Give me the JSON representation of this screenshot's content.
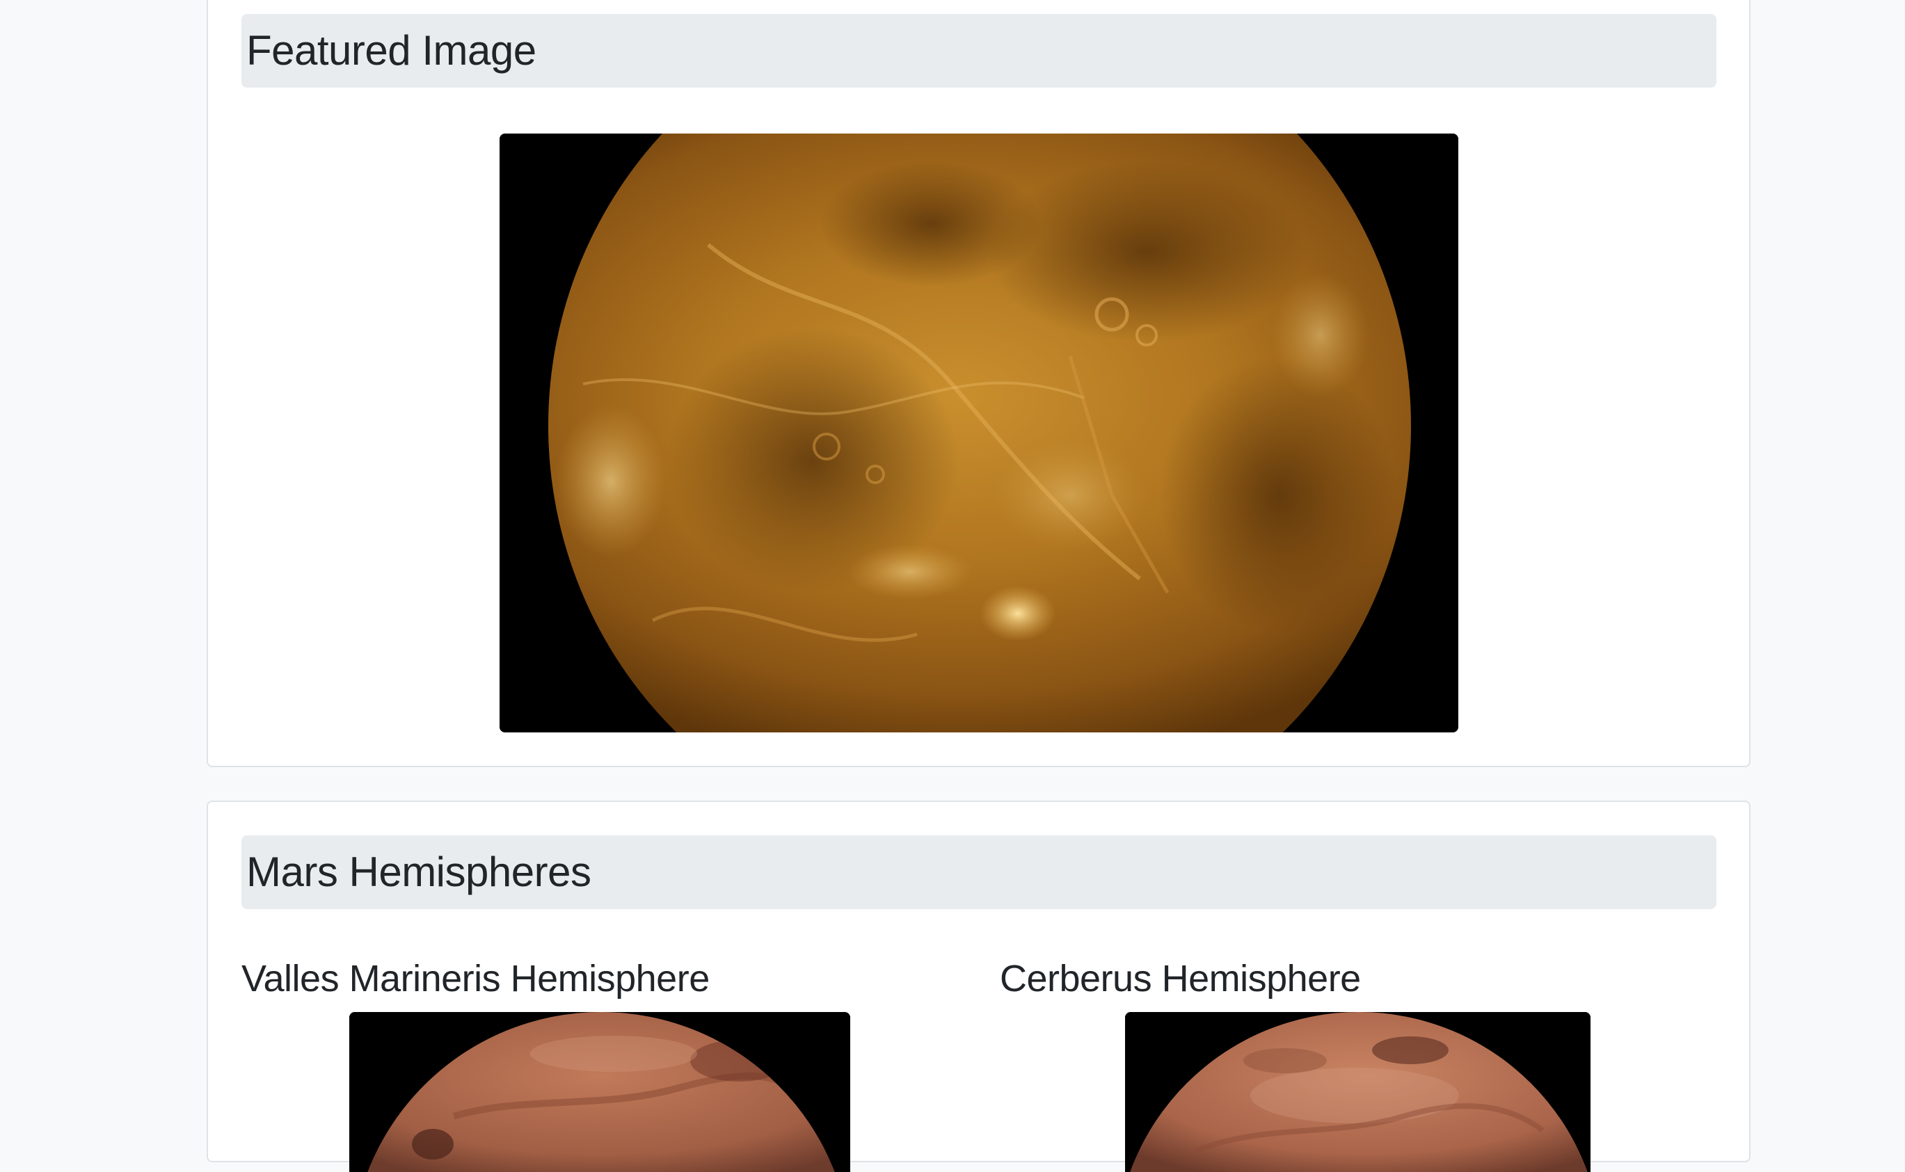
{
  "featured": {
    "title": "Featured Image",
    "image_subject": "venus-globe-image"
  },
  "hemispheres": {
    "title": "Mars Hemispheres",
    "items": [
      {
        "title": "Valles Marineris Hemisphere",
        "image_subject": "mars-globe-image"
      },
      {
        "title": "Cerberus Hemisphere",
        "image_subject": "mars-globe-image"
      }
    ]
  },
  "colors": {
    "page_background": "#f8f9fa",
    "card_background": "#ffffff",
    "header_background": "#e9ecef",
    "text": "#212529",
    "image_background": "#000000"
  }
}
